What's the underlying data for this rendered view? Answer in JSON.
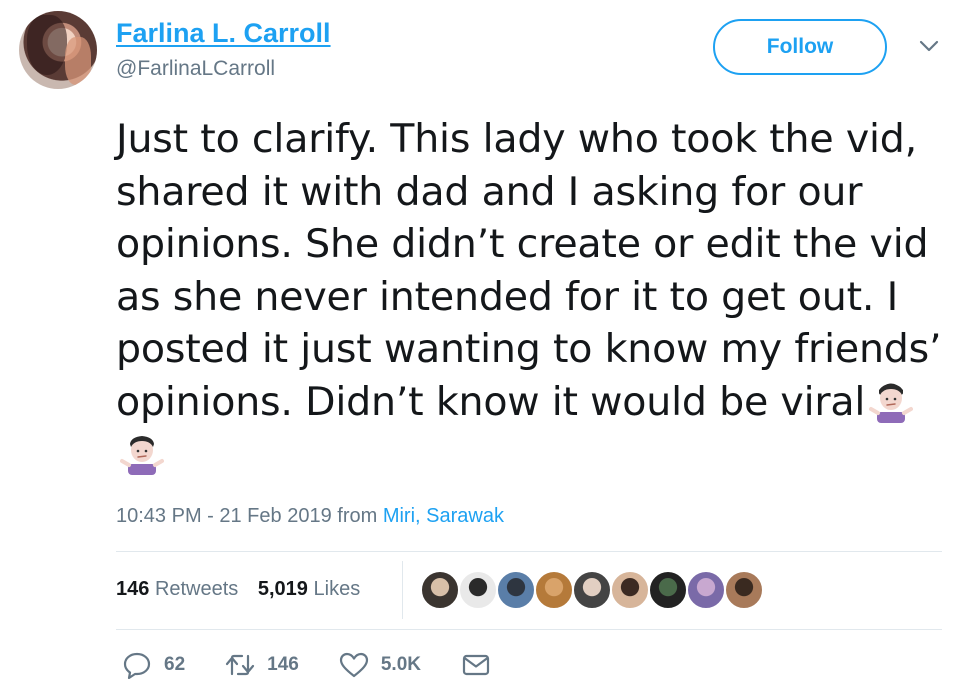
{
  "user": {
    "display_name": "Farlina L. Carroll",
    "handle": "@FarlinaLCarroll"
  },
  "follow_label": "Follow",
  "tweet": {
    "text": "Just to clarify. This lady who took the vid, shared it with dad and I asking for our opinions. She didn’t create or edit the vid as she never intended for it to get out. I posted it just wanting to know my friends’ opinions. Didn’t know it would be viral",
    "emojis": [
      "person-shrugging-icon",
      "person-shrugging-icon"
    ]
  },
  "meta": {
    "timestamp": "10:43 PM - 21 Feb 2019",
    "from_label": "from",
    "location": "Miri, Sarawak"
  },
  "stats": {
    "retweets_count": "146",
    "retweets_label": "Retweets",
    "likes_count": "5,019",
    "likes_label": "Likes"
  },
  "liker_avatars": [
    {
      "color_a": "#3b3530",
      "color_b": "#d8c0a8"
    },
    {
      "color_a": "#e9e9e9",
      "color_b": "#2a2a2a"
    },
    {
      "color_a": "#5a7ea8",
      "color_b": "#2e3540"
    },
    {
      "color_a": "#b57a3a",
      "color_b": "#d9a36a"
    },
    {
      "color_a": "#444444",
      "color_b": "#e2cfc2"
    },
    {
      "color_a": "#d7b59a",
      "color_b": "#3c2a22"
    },
    {
      "color_a": "#222222",
      "color_b": "#4a6a4a"
    },
    {
      "color_a": "#7a6aa8",
      "color_b": "#c8a8d0"
    },
    {
      "color_a": "#a87a5a",
      "color_b": "#3a2a20"
    }
  ],
  "actions": {
    "reply_count": "62",
    "retweet_count": "146",
    "like_count": "5.0K"
  },
  "colors": {
    "accent": "#1da1f2",
    "muted": "#657786",
    "text": "#14171a"
  }
}
